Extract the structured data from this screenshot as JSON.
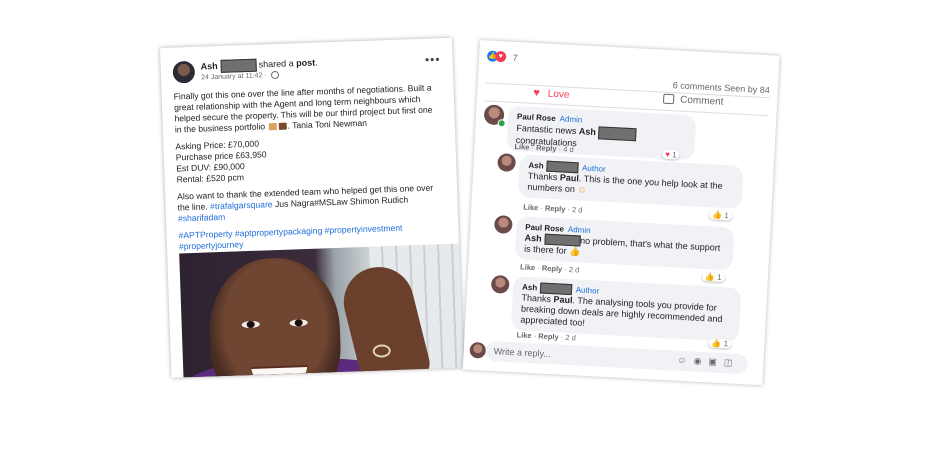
{
  "post": {
    "author": "Ash",
    "shared_text": "shared a",
    "shared_object": "post",
    "date": "24 January at 11:42",
    "more_icon": "more-options-icon",
    "paragraph1": [
      "Finally got this one over the line after months of negotiations. Built a",
      "great relationship with the Agent and long term neighbours which",
      "helped secure the property. This will be our third project but first one",
      "in the business portfolio"
    ],
    "tag_names": "Tania Toni Newman",
    "figures": [
      "Asking Price: £70,000",
      "Purchase price £63,950",
      "Est DUV: £90,000",
      "Rental: £520 pcm"
    ],
    "thanks_line1": "Also want to thank the extended team who helped get this one over",
    "thanks_line2_prefix": "the line.",
    "hashtag_trafalgar": "#trafalgarsquare",
    "thanks_line2_names": "Jus Nagra#MSLaw Shimon Rudich",
    "hashtag_sharif": "#sharifadam",
    "hashtags_line": "#APTProperty #aptpropertypackaging #propertyinvestment",
    "hashtag_journey": "#propertyjourney"
  },
  "engagement": {
    "reaction_count": "7",
    "stats": "6 comments  Seen by 84",
    "love_label": "Love",
    "comment_label": "Comment"
  },
  "comments": [
    {
      "name": "Paul Rose",
      "badge": "Admin",
      "text_before": "Fantastic news",
      "mention": "Ash",
      "text_after": "congratulations",
      "like": "Like",
      "reply": "Reply",
      "age": "4 d",
      "reaction_count": "1"
    },
    {
      "name": "Ash",
      "badge": "Author",
      "text": "Thanks Paul. This is the one you help look at the numbers on",
      "line1_pre": "Thanks",
      "line1_bold": "Paul",
      "line1_post": ". This is the one you help look at the",
      "line2": "numbers on",
      "like": "Like",
      "reply": "Reply",
      "age": "2 d",
      "reaction_count": "1"
    },
    {
      "name": "Paul Rose",
      "badge": "Admin",
      "mention": "Ash",
      "line1_post": "no problem, that's what the support",
      "line2": "is there for",
      "like": "Like",
      "reply": "Reply",
      "age": "2 d",
      "reaction_count": "1"
    },
    {
      "name": "Ash",
      "badge": "Author",
      "line1_pre": "Thanks",
      "line1_bold": "Paul",
      "line1_post": ". The analysing tools you provide for",
      "line2": "breaking down deals are highly recommended and",
      "line3": "appreciated too!",
      "like": "Like",
      "reply": "Reply",
      "age": "2 d",
      "reaction_count": "1"
    }
  ],
  "reply_box": {
    "placeholder": "Write a reply..."
  }
}
